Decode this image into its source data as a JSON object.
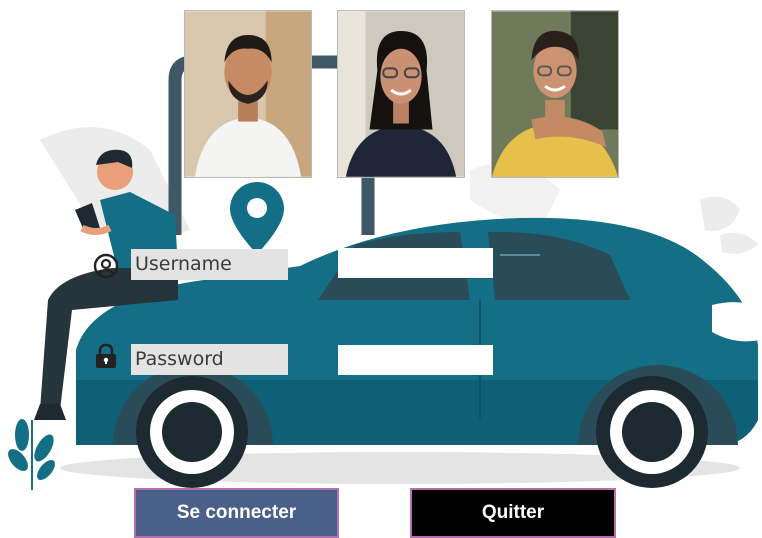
{
  "window": {
    "background": "#ffffff"
  },
  "colors": {
    "car_teal": "#146f86",
    "connect_bg": "#4a6088",
    "quit_bg": "#000000",
    "button_border": "#b86fae",
    "label_bg": "#e3e3e3"
  },
  "team_photos": [
    {
      "name": "team-member-1"
    },
    {
      "name": "team-member-2"
    },
    {
      "name": "team-member-3"
    }
  ],
  "login_form": {
    "username_label": "Username",
    "username_icon": "user-circle-icon",
    "username_value": "",
    "password_label": "Password",
    "password_icon": "lock-icon",
    "password_value": ""
  },
  "buttons": {
    "connect_label": "Se connecter",
    "quit_label": "Quitter"
  }
}
